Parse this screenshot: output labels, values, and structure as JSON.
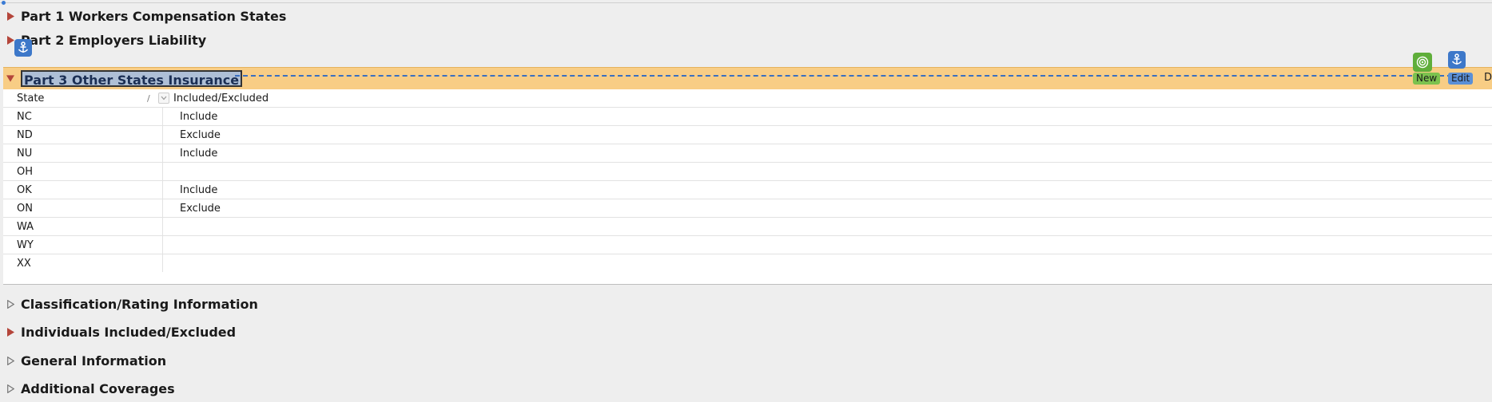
{
  "sections_top": [
    {
      "title": "Part 1 Workers Compensation States",
      "state": "collapsed-filled"
    },
    {
      "title": "Part 2 Employers Liability",
      "state": "collapsed-filled"
    }
  ],
  "expanded_section": {
    "title": "Part 3 Other States Insurance",
    "state": "expanded",
    "new_label": "New",
    "edit_label": "Edit",
    "trailing_text": "D",
    "icons": {
      "anchor": "anchor-icon",
      "new": "target-icon"
    },
    "colors": {
      "header_bg": "#f8cd85",
      "selection_bg": "#aebfd6",
      "new_badge": "#5fae3a",
      "anchor_badge": "#3d78c9"
    }
  },
  "grid": {
    "columns": [
      "State",
      "Included/Excluded"
    ],
    "rows": [
      {
        "state": "NC",
        "value": "Include"
      },
      {
        "state": "ND",
        "value": "Exclude"
      },
      {
        "state": "NU",
        "value": "Include"
      },
      {
        "state": "OH",
        "value": ""
      },
      {
        "state": "OK",
        "value": "Include"
      },
      {
        "state": "ON",
        "value": "Exclude"
      },
      {
        "state": "WA",
        "value": ""
      },
      {
        "state": "WY",
        "value": ""
      },
      {
        "state": "XX",
        "value": ""
      }
    ]
  },
  "sections_bottom": [
    {
      "title": "Classification/Rating Information",
      "state": "collapsed-outline"
    },
    {
      "title": "Individuals Included/Excluded",
      "state": "collapsed-filled"
    },
    {
      "title": "General Information",
      "state": "collapsed-outline"
    },
    {
      "title": "Additional Coverages",
      "state": "collapsed-outline"
    }
  ]
}
